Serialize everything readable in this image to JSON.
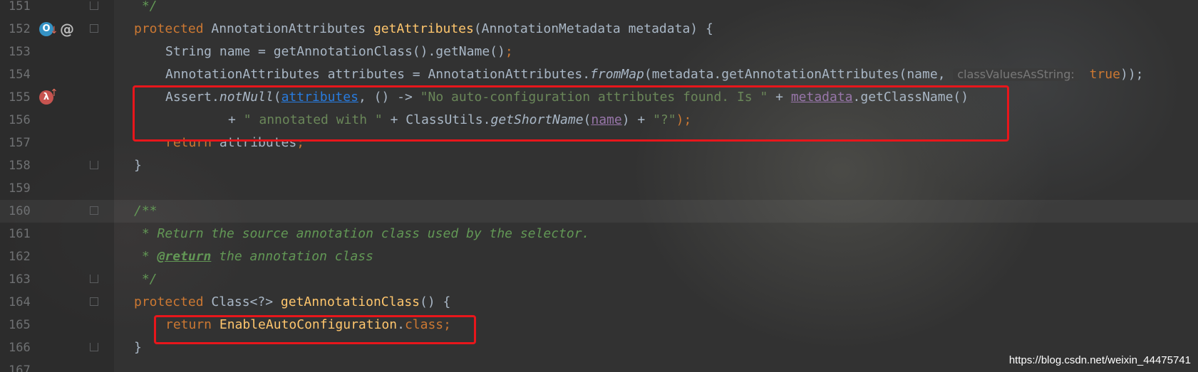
{
  "editor": {
    "lines": [
      {
        "number": "151"
      },
      {
        "number": "152"
      },
      {
        "number": "153"
      },
      {
        "number": "154"
      },
      {
        "number": "155"
      },
      {
        "number": "156"
      },
      {
        "number": "157"
      },
      {
        "number": "158"
      },
      {
        "number": "159"
      },
      {
        "number": "160"
      },
      {
        "number": "161"
      },
      {
        "number": "162"
      },
      {
        "number": "163"
      },
      {
        "number": "164"
      },
      {
        "number": "165"
      },
      {
        "number": "166"
      },
      {
        "number": "167"
      }
    ],
    "gutter_icons": {
      "override": "O",
      "at": "@",
      "lambda": "λ",
      "down_arrow": "↓",
      "up_arrow": "↑"
    },
    "code": {
      "l151": {
        "comment": " */"
      },
      "l152": {
        "kw": "protected ",
        "type": "AnnotationAttributes ",
        "method": "getAttributes",
        "rest": "(AnnotationMetadata metadata) {"
      },
      "l153": {
        "text": "String name = getAnnotationClass().getName()",
        "semi": ";"
      },
      "l154": {
        "pre": "AnnotationAttributes attributes = AnnotationAttributes.",
        "fromMap": "fromMap",
        "mid": "(metadata.getAnnotationAttributes(name, ",
        "hint_name": "classValuesAsString:",
        "hint_val": " true",
        "end": "));"
      },
      "l155": {
        "pre": "Assert.",
        "notNull": "notNull",
        "paren": "(",
        "attributes": "attributes",
        "mid": ", () -> ",
        "str": "\"No auto-configuration attributes found. Is \"",
        "plus": " + ",
        "metadata": "metadata",
        "end": ".getClassName()"
      },
      "l156": {
        "plus1": "+ ",
        "str1": "\" annotated with \"",
        "plus2": " + ClassUtils.",
        "getShortName": "getShortName",
        "paren": "(",
        "name": "name",
        "close": ") + ",
        "str2": "\"?\"",
        "end": ");"
      },
      "l157": {
        "kw": "return ",
        "text": "attributes",
        "semi": ";"
      },
      "l158": {
        "text": "}"
      },
      "l160": {
        "comment": "/**"
      },
      "l161": {
        "comment": " * Return the source annotation class used by the selector."
      },
      "l162": {
        "star": " * ",
        "tag": "@return",
        "comment": " the annotation class"
      },
      "l163": {
        "comment": " */"
      },
      "l164": {
        "kw": "protected ",
        "type": "Class<?> ",
        "method": "getAnnotationClass",
        "rest": "() {"
      },
      "l165": {
        "kw": "return ",
        "type": "EnableAutoConfiguration",
        "dot": ".",
        "kw2": "class",
        "semi": ";"
      },
      "l166": {
        "text": "}"
      }
    }
  },
  "watermark": "https://blog.csdn.net/weixin_44475741"
}
